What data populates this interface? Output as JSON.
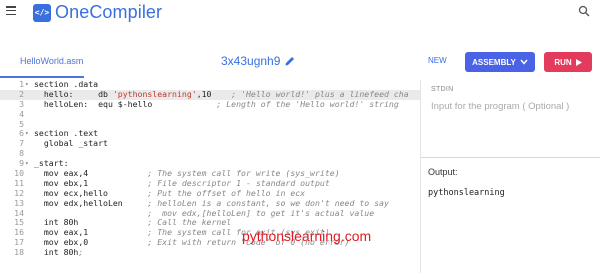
{
  "app": {
    "brand_name": "OneCompiler",
    "brand_logo_glyph": "</>",
    "brand_color": "#3a6fe0"
  },
  "toolbar": {
    "file_tab": "HelloWorld.asm",
    "project_id": "3x43ugnh9",
    "new_label": "NEW",
    "language_label": "ASSEMBLY",
    "run_label": "RUN",
    "language_color": "#4a62e6",
    "run_color": "#e33b5b"
  },
  "editor": {
    "lines": [
      {
        "n": "1",
        "fold": "▾",
        "code": "section .data"
      },
      {
        "n": "2",
        "fold": "",
        "code": "  hello:     db 'pythonslearning',10    ; 'Hello world!' plus a linefeed cha",
        "active": true
      },
      {
        "n": "3",
        "fold": "",
        "code": "  helloLen:  equ $-hello             ; Length of the 'Hello world!' string"
      },
      {
        "n": "4",
        "fold": "",
        "code": ""
      },
      {
        "n": "5",
        "fold": "",
        "code": ""
      },
      {
        "n": "6",
        "fold": "▾",
        "code": "section .text"
      },
      {
        "n": "7",
        "fold": "",
        "code": "  global _start"
      },
      {
        "n": "8",
        "fold": "",
        "code": ""
      },
      {
        "n": "9",
        "fold": "▾",
        "code": "_start:"
      },
      {
        "n": "10",
        "fold": "",
        "code": "  mov eax,4            ; The system call for write (sys_write)"
      },
      {
        "n": "11",
        "fold": "",
        "code": "  mov ebx,1            ; File descriptor 1 - standard output"
      },
      {
        "n": "12",
        "fold": "",
        "code": "  mov ecx,hello        ; Put the offset of hello in ecx"
      },
      {
        "n": "13",
        "fold": "",
        "code": "  mov edx,helloLen     ; helloLen is a constant, so we don't need to say"
      },
      {
        "n": "14",
        "fold": "",
        "code": "                       ;  mov edx,[helloLen] to get it's actual value"
      },
      {
        "n": "15",
        "fold": "",
        "code": "  int 80h              ; Call the kernel"
      },
      {
        "n": "16",
        "fold": "",
        "code": "  mov eax,1            ; The system call for exit (sys_exit)"
      },
      {
        "n": "17",
        "fold": "",
        "code": "  mov ebx,0            ; Exit with return \"code\" of 0 (no error)"
      },
      {
        "n": "18",
        "fold": "",
        "code": "  int 80h;"
      }
    ]
  },
  "stdin": {
    "label": "STDIN",
    "placeholder": "Input for the program ( Optional )"
  },
  "output": {
    "label": "Output:",
    "text": "pythonslearning"
  },
  "watermark": "pythonslearning.com"
}
